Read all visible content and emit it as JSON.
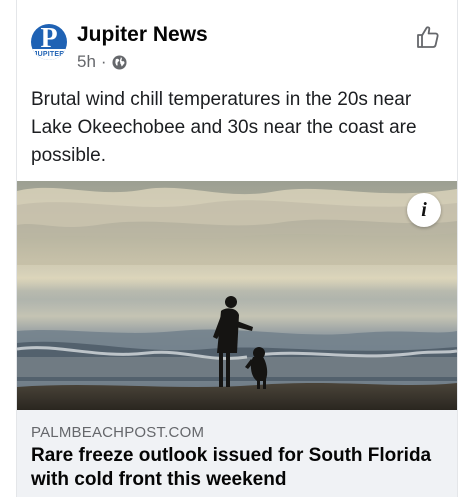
{
  "post": {
    "page_name": "Jupiter News",
    "avatar_letter": "P",
    "avatar_strip": "JUPITER",
    "time": "5h",
    "separator": "·",
    "audience_icon": "globe-icon",
    "like_icon": "thumbs-up-icon",
    "text": "Brutal wind chill temperatures in the 20s near Lake Okeechobee and 30s near the coast are possible."
  },
  "photo": {
    "info_label": "i",
    "subject": "beach-photo"
  },
  "link": {
    "domain": "PALMBEACHPOST.COM",
    "headline": "Rare freeze outlook issued for South Florida with cold front this weekend"
  },
  "colors": {
    "brand": "#1f62b4",
    "secondary_text": "#65676b",
    "preview_bg": "#f0f2f5"
  }
}
